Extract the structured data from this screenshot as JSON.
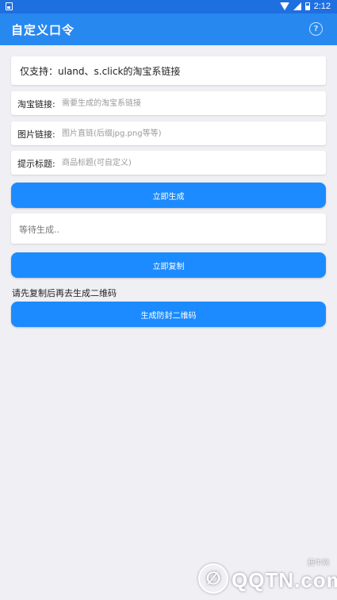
{
  "status_bar": {
    "time": "2:12"
  },
  "app_bar": {
    "title": "自定义口令",
    "help_icon": "help-circle-icon"
  },
  "notice": {
    "text": "仅支持：uland、s.click的淘宝系链接"
  },
  "form": {
    "taobao_link": {
      "label": "淘宝链接:",
      "placeholder": "需要生成的淘宝系链接",
      "value": ""
    },
    "image_link": {
      "label": "图片链接:",
      "placeholder": "图片直链(后缀jpg.png等等)",
      "value": ""
    },
    "title": {
      "label": "提示标题:",
      "placeholder": "商品标题(可自定义)",
      "value": ""
    }
  },
  "buttons": {
    "generate": "立即生成",
    "copy": "立即复制",
    "qr": "生成防封二维码"
  },
  "output": {
    "text": "等待生成.."
  },
  "hint": "请先复制后再去生成二维码",
  "watermark": {
    "brand": "QQTN.com",
    "small": "腾牛网",
    "logo_char": "∅"
  },
  "colors": {
    "primary": "#1c8bff",
    "app_bar": "#2789f0",
    "status_bar": "#1e6fe0",
    "background": "#efeff4"
  }
}
